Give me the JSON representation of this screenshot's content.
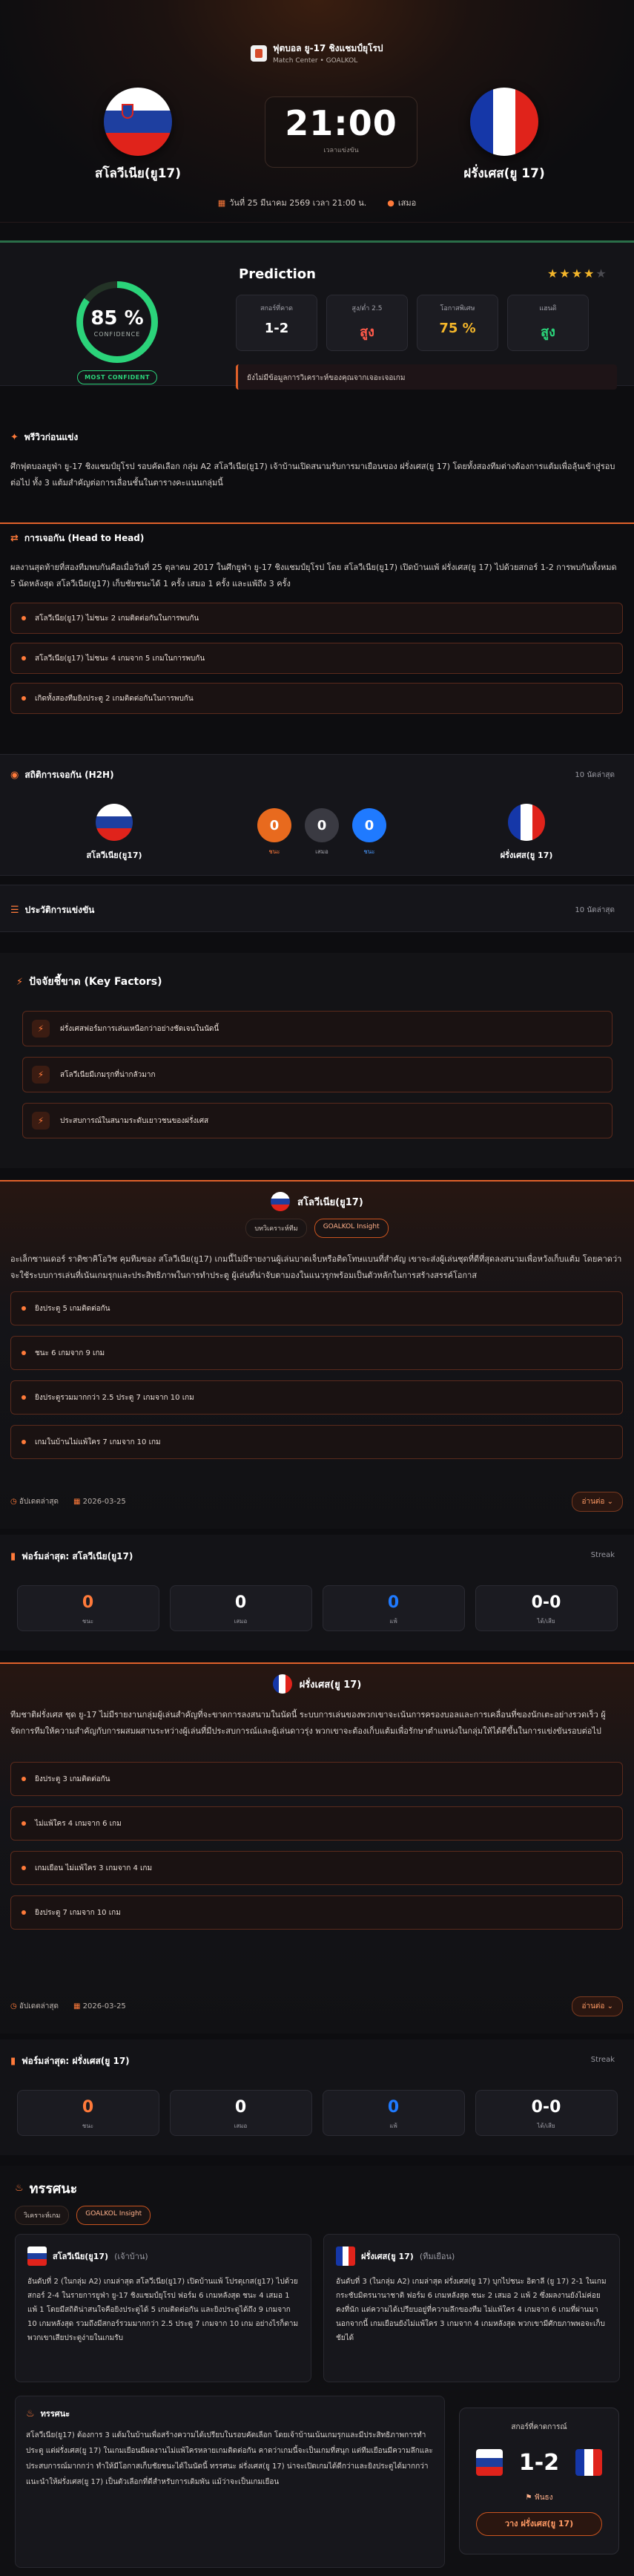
{
  "header": {
    "league_name": "ฟุตบอล ยู-17 ชิงแชมป์ยุโรป",
    "breadcrumb": "Match Center • GOALKOL",
    "home_team": "สโลวีเนีย(ยู17)",
    "away_team": "ฝรั่งเศส(ยู 17)",
    "kickoff_time": "21:00",
    "kickoff_label": "เวลาแข่งขัน",
    "date_text": "วันที่ 25 มีนาคม 2569 เวลา 21:00 น.",
    "status_text": "เสมอ"
  },
  "prediction": {
    "confidence_percent": "85 %",
    "confidence_value": 85,
    "confidence_label": "CONFIDENCE",
    "confident_badge": "MOST CONFIDENT",
    "title": "Prediction",
    "stars_filled": 4,
    "stars_total": 5,
    "cards": [
      {
        "label": "สกอร์ที่คาด",
        "value": "1-2",
        "color": "#ffffff"
      },
      {
        "label": "สูง/ต่ำ 2.5",
        "value": "สูง",
        "color": "#ff5a4a"
      },
      {
        "label": "โอกาสพิเศษ",
        "value": "75 %",
        "color": "#f4b62a"
      },
      {
        "label": "แฮนดิ",
        "value": "สูง",
        "color": "#2bd37a"
      }
    ],
    "note": "ยังไม่มีข้อมูลการวิเคราะห์ของคุณจากเจอะเจอเกม"
  },
  "preview": {
    "title": "พรีวิวก่อนแข่ง",
    "text": "ศึกฟุตบอลยูฟ่า ยู-17 ชิงแชมป์ยุโรป รอบคัดเลือก กลุ่ม A2 สโลวีเนีย(ยู17) เจ้าบ้านเปิดสนามรับการมาเยือนของ ฝรั่งเศส(ยู 17) โดยทั้งสองทีมต่างต้องการแต้มเพื่อลุ้นเข้าสู่รอบต่อไป ทั้ง 3 แต้มสำคัญต่อการเลื่อนชั้นในตารางคะแนนกลุ่มนี้"
  },
  "h2h_record": {
    "title": "การเจอกัน (Head to Head)",
    "text": "ผลงานสุดท้ายที่สองทีมพบกันคือเมื่อวันที่ 25 ตุลาคม 2017 ในศึกยูฟ่า ยู-17 ชิงแชมป์ยุโรป โดย สโลวีเนีย(ยู17) เปิดบ้านแพ้ ฝรั่งเศส(ยู 17) ไปด้วยสกอร์ 1-2 การพบกันทั้งหมด 5 นัดหลังสุด สโลวีเนีย(ยู17) เก็บชัยชนะได้ 1 ครั้ง เสมอ 1 ครั้ง และแพ้ถึง 3 ครั้ง",
    "items": [
      "สโลวีเนีย(ยู17) ไม่ชนะ 2 เกมติดต่อกันในการพบกัน",
      "สโลวีเนีย(ยู17) ไม่ชนะ 4 เกมจาก 5 เกมในการพบกัน",
      "เกิดทั้งสองทีมยิงประตู 2 เกมติดต่อกันในการพบกัน"
    ]
  },
  "h2h_stats": {
    "title": "สถิติการเจอกัน (H2H)",
    "count_label": "10 นัดล่าสุด",
    "home_wins": "0",
    "draws": "0",
    "away_wins": "0",
    "home_win_label": "ชนะ",
    "draw_label": "เสมอ",
    "away_win_label": "ชนะ"
  },
  "history": {
    "title": "ประวัติการแข่งขัน",
    "count_label": "10 นัดล่าสุด"
  },
  "key_factors": {
    "title": "ปัจจัยชี้ขาด (Key Factors)",
    "items": [
      "ฝรั่งเศสฟอร์มการเล่นเหนือกว่าอย่างชัดเจนในนัดนี้",
      "สโลวีเนียมีเกมรุกที่น่ากลัวมาก",
      "ประสบการณ์ในสนามระดับเยาวชนของฝรั่งเศส"
    ]
  },
  "home_analysis": {
    "name": "สโลวีเนีย(ยู17)",
    "tag_1": "บทวิเคราะห์ทีม",
    "tag_2": "GOALKOL Insight",
    "text": "อะเล็กซานเดอร์ ราดิซาคิโอวิช คุมทีมของ สโลวีเนีย(ยู17) เกมนี้ไม่มีรายงานผู้เล่นบาดเจ็บหรือติดโทษแบนที่สำคัญ เขาจะส่งผู้เล่นชุดที่ดีที่สุดลงสนามเพื่อหวังเก็บแต้ม โดยคาดว่าจะใช้ระบบการเล่นที่เน้นเกมรุกและประสิทธิภาพในการทำประตู ผู้เล่นที่น่าจับตามองในแนวรุกพร้อมเป็นตัวหลักในการสร้างสรรค์โอกาส",
    "items": [
      "ยิงประตู 5 เกมติดต่อกัน",
      "ชนะ 6 เกมจาก 9 เกม",
      "ยิงประตูรวมมากกว่า 2.5 ประตู 7 เกมจาก 10 เกม",
      "เกมในบ้านไม่แพ้ใคร 7 เกมจาก 10 เกม"
    ],
    "author": "อัปเดตล่าสุด",
    "date": "2026-03-25",
    "readmore": "อ่านต่อ"
  },
  "home_form": {
    "title": "ฟอร์มล่าสุด: สโลวีเนีย(ยู17)",
    "streak_label": "Streak",
    "win": "0",
    "draw": "0",
    "loss": "0",
    "goals": "0-0",
    "win_label": "ชนะ",
    "draw_label": "เสมอ",
    "loss_label": "แพ้",
    "goals_label": "ได้/เสีย"
  },
  "away_analysis": {
    "name": "ฝรั่งเศส(ยู 17)",
    "text": "ทีมชาติฝรั่งเศส ชุด ยู-17 ไม่มีรายงานกลุ่มผู้เล่นสำคัญที่จะขาดการลงสนามในนัดนี้ ระบบการเล่นของพวกเขาจะเน้นการครองบอลและการเคลื่อนที่ของนักเตะอย่างรวดเร็ว ผู้จัดการทีมให้ความสำคัญกับการผสมผสานระหว่างผู้เล่นที่มีประสบการณ์และผู้เล่นดาวรุ่ง พวกเขาจะต้องเก็บแต้มเพื่อรักษาตำแหน่งในกลุ่มให้ได้ดีขึ้นในการแข่งขันรอบต่อไป",
    "items": [
      "ยิงประตู 3 เกมติดต่อกัน",
      "ไม่แพ้ใคร 4 เกมจาก 6 เกม",
      "เกมเยือน ไม่แพ้ใคร 3 เกมจาก 4 เกม",
      "ยิงประตู 7 เกมจาก 10 เกม"
    ],
    "date": "2026-03-25"
  },
  "away_form": {
    "title": "ฟอร์มล่าสุด: ฝรั่งเศส(ยู 17)",
    "win": "0",
    "draw": "0",
    "loss": "0",
    "goals": "0-0"
  },
  "summary": {
    "title": "ทรรศนะ",
    "tag_1": "วิเคราะห์เกม",
    "tag_2": "GOALKOL Insight",
    "home_head": "สโลวีเนีย(ยู17)",
    "home_role": "(เจ้าบ้าน)",
    "home_text": "อันดับที่ 2 (ในกลุ่ม A2) เกมล่าสุด สโลวีเนีย(ยู17) เปิดบ้านแพ้ โปรตุเกส(ยู17) ไปด้วยสกอร์ 2-4 ในรายการยูฟ่า ยู-17 ชิงแชมป์ยุโรป ฟอร์ม 6 เกมหลังสุด ชนะ 4 เสมอ 1 แพ้ 1 โดยมีสถิติน่าสนใจคือยิงประตูได้ 5 เกมติดต่อกัน และยิงประตูได้ถึง 9 เกมจาก 10 เกมหลังสุด รวมถึงมีสกอร์รวมมากกว่า 2.5 ประตู 7 เกมจาก 10 เกม อย่างไรก็ตาม พวกเขาเสียประตูง่ายในเกมรับ",
    "away_head": "ฝรั่งเศส(ยู 17)",
    "away_role": "(ทีมเยือน)",
    "away_text": "อันดับที่ 3 (ในกลุ่ม A2) เกมล่าสุด ฝรั่งเศส(ยู 17) บุกไปชนะ อิตาลี (ยู 17) 2-1 ในเกมกระชับมิตรนานาชาติ ฟอร์ม 6 เกมหลังสุด ชนะ 2 เสมอ 2 แพ้ 2 ซึ่งผลงานยังไม่ค่อยคงที่นัก แต่ความได้เปรียบอยู่ที่ความลึกของทีม ไม่แพ้ใคร 4 เกมจาก 6 เกมที่ผ่านมา นอกจากนี้ เกมเยือนยังไม่แพ้ใคร 3 เกมจาก 4 เกมหลังสุด พวกเขามีศักยภาพพอจะเก็บชัยได้",
    "verdict_title": "ทรรศนะ",
    "verdict_text": "สโลวีเนีย(ยู17) ต้องการ 3 แต้มในบ้านเพื่อสร้างความได้เปรียบในรอบคัดเลือก โดยเจ้าบ้านเน้นเกมรุกและมีประสิทธิภาพการทำประตู แต่ฝรั่งเศส(ยู 17) ในเกมเยือนมีผลงานไม่แพ้ใครหลายเกมติดต่อกัน คาดว่าเกมนี้จะเป็นเกมที่สนุก แต่ทีมเยือนมีความลึกและประสบการณ์มากกว่า ทำให้มีโอกาสเก็บชัยชนะได้ในนัดนี้ ทรรศนะ ฝรั่งเศส(ยู 17) น่าจะเปิดเกมได้ดีกว่าและยิงประตูได้มากกว่า แนะนำให้ฝรั่งเศส(ยู 17) เป็นตัวเลือกที่ดีสำหรับการเดิมพัน แม้ว่าจะเป็นเกมเยือน",
    "predict_label": "สกอร์ที่คาดการณ์",
    "predict_score": "1-2",
    "result_label": "ฟันธง",
    "pick_button": "วาง ฝรั่งเศส(ยู 17)"
  },
  "colors": {
    "accent": "#ff7a3a",
    "green": "#2bd37a",
    "draw": "#3a3a42",
    "away": "#1f7aff"
  }
}
